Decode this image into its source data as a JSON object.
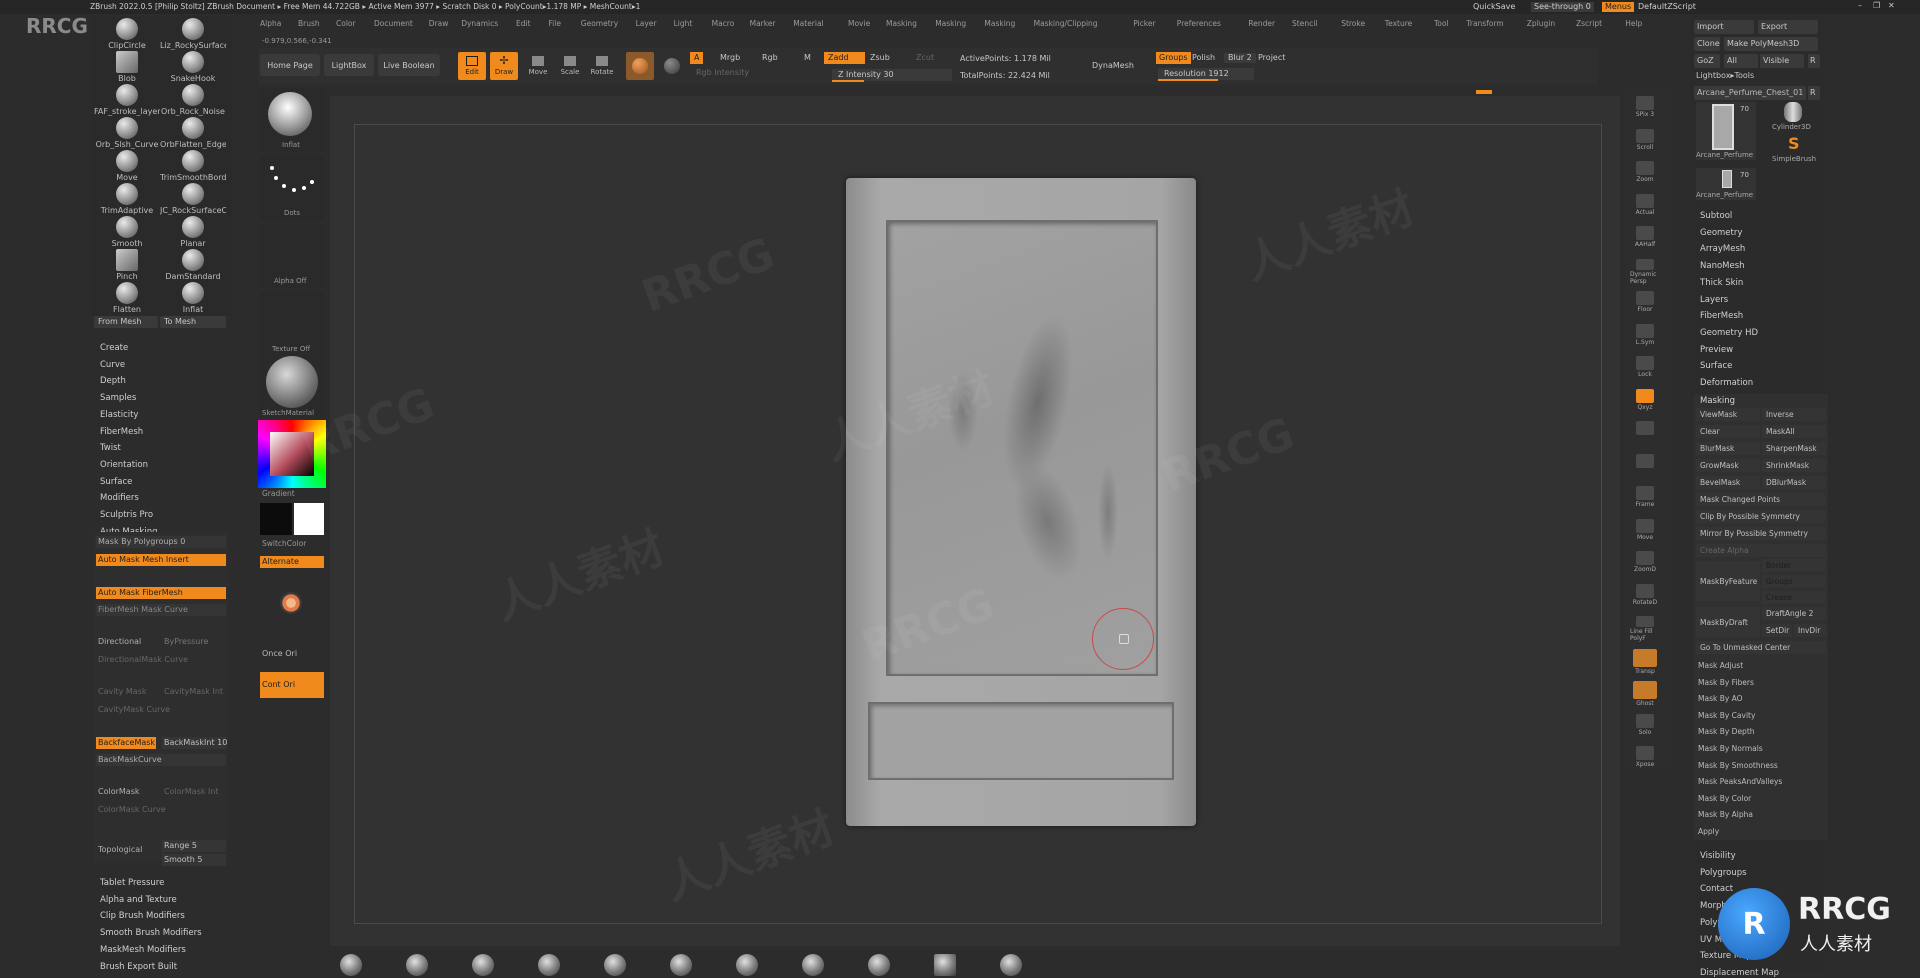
{
  "title_bar": {
    "text": "ZBrush 2022.0.5 [Philip Stoltz]   ZBrush Document   ▸ Free Mem 44.722GB ▸ Active Mem 3977 ▸ Scratch Disk 0 ▸ PolyCount▸1.178 MP ▸ MeshCount▸1",
    "quicksave": "QuickSave",
    "see_through": "See-through  0",
    "menus": "Menus",
    "default_script": "DefaultZScript"
  },
  "menu_bar": [
    "Alpha",
    "Brush",
    "Color",
    "Document",
    "Draw",
    "Dynamics",
    "Edit",
    "File",
    "Geometry",
    "Layer",
    "Light",
    "Macro",
    "Marker",
    "Material",
    "Movie",
    "Masking",
    "Masking",
    "Masking",
    "Masking/Clipping",
    "Picker",
    "Preferences",
    "Render",
    "Stencil",
    "Stroke",
    "Texture",
    "Tool",
    "Transform",
    "Zplugin",
    "Zscript",
    "Help"
  ],
  "coords": "-0.979,0.566,-0.341",
  "top_shelf": {
    "home_page": "Home Page",
    "lightbox": "LightBox",
    "live_boolean": "Live Boolean",
    "edit": "Edit",
    "draw": "Draw",
    "move": "Move",
    "scale": "Scale",
    "rotate": "Rotate",
    "a_label": "A",
    "mrgb": "Mrgb",
    "rgb": "Rgb",
    "m": "M",
    "zadd": "Zadd",
    "zsub": "Zsub",
    "zcut": "Zcut",
    "rgb_intensity": "Rgb Intensity",
    "z_intensity": "Z Intensity 30",
    "active_points": "ActivePoints: 1.178 Mil",
    "total_points": "TotalPoints: 22.424 Mil",
    "dynamesh": "DynaMesh",
    "groups": "Groups",
    "polish": "Polish",
    "blur": "Blur 2",
    "project": "Project",
    "resolution": "Resolution 1912"
  },
  "brushes": [
    {
      "name": "ClipCircle"
    },
    {
      "name": "Liz_RockySurface"
    },
    {
      "name": "Blob"
    },
    {
      "name": "SnakeHook"
    },
    {
      "name": "FAF_stroke_layer"
    },
    {
      "name": "Orb_Rock_Noise"
    },
    {
      "name": "Orb_Slsh_Curve"
    },
    {
      "name": "OrbFlatten_Edge"
    },
    {
      "name": "Move"
    },
    {
      "name": "TrimSmoothBord"
    },
    {
      "name": "TrimAdaptive"
    },
    {
      "name": "JC_RockSurfaceC"
    },
    {
      "name": "Smooth"
    },
    {
      "name": "Planar"
    },
    {
      "name": "Pinch"
    },
    {
      "name": "DamStandard"
    },
    {
      "name": "Flatten"
    },
    {
      "name": "Inflat"
    }
  ],
  "from_mesh": "From Mesh",
  "to_mesh": "To Mesh",
  "left_menu": [
    "Create",
    "Curve",
    "Depth",
    "Samples",
    "Elasticity",
    "FiberMesh",
    "Twist",
    "Orientation",
    "Surface",
    "Modifiers",
    "Sculptris Pro",
    "Auto Masking"
  ],
  "auto_masking": {
    "mask_by_polygroups": "Mask By Polygroups 0",
    "auto_mask_mesh_insert": "Auto Mask Mesh Insert",
    "auto_mask_fibermesh": "Auto Mask FiberMesh",
    "fibermesh_mask_curve": "FiberMesh Mask Curve",
    "directional": "Directional",
    "by_pressure": "ByPressure",
    "directional_mask_curve": "DirectionalMask Curve",
    "cavity_mask": "Cavity Mask",
    "cavity_mask_int": "CavityMask Int",
    "cavity_mask_curve": "CavityMask Curve",
    "backface_mask": "BackfaceMask",
    "backmask_int": "BackMaskInt 10",
    "backmask_curve": "BackMaskCurve",
    "color_mask": "ColorMask",
    "color_mask_int": "ColorMask Int",
    "color_mask_curve": "ColorMask Curve",
    "topological": "Topological",
    "range": "Range 5",
    "smooth": "Smooth 5"
  },
  "left_bottom_menu": [
    "Tablet Pressure",
    "Alpha and Texture",
    "Clip Brush Modifiers",
    "Smooth Brush Modifiers",
    "MaskMesh Modifiers",
    "Brush Export Built"
  ],
  "palette": {
    "inflat": "Inflat",
    "dots": "Dots",
    "alpha_off": "Alpha Off",
    "texture_off": "Texture Off",
    "material": "SketchMaterial",
    "gradient": "Gradient",
    "switch_color": "SwitchColor",
    "alternate": "Alternate",
    "once_ori": "Once Ori",
    "cont_ori": "Cont Ori"
  },
  "right_tools": [
    "SPix 3",
    "Scroll",
    "Zoom",
    "Actual",
    "AAHalf",
    "Dynamic Persp",
    "Floor",
    "L.Sym",
    "Lock",
    "Qxyz",
    "",
    "",
    "Frame",
    "Move",
    "ZoomD",
    "RotateD",
    "Line Fill PolyF",
    "Transp",
    "Ghost",
    "Solo",
    "Xpose"
  ],
  "tool_panel": {
    "import": "Import",
    "export": "Export",
    "clone": "Clone",
    "make_polymesh": "Make PolyMesh3D",
    "goz": "GoZ",
    "all": "All",
    "visible": "Visible",
    "r": "R",
    "lightbox_tools": "Lightbox▸Tools",
    "current_tool": "Arcane_Perfume_Chest_01",
    "tool_count_1": "70",
    "tool_name_1": "Arcane_Perfume",
    "cylinder": "Cylinder3D",
    "simplebrush": "SimpleBrush",
    "tool_count_2": "70",
    "tool_name_2": "Arcane_Perfume"
  },
  "tool_menu": [
    "Subtool",
    "Geometry",
    "ArrayMesh",
    "NanoMesh",
    "Thick Skin",
    "Layers",
    "FiberMesh",
    "Geometry HD",
    "Preview",
    "Surface",
    "Deformation"
  ],
  "masking": {
    "title": "Masking",
    "view_mask": "ViewMask",
    "inverse": "Inverse",
    "clear": "Clear",
    "mask_all": "MaskAll",
    "blur_mask": "BlurMask",
    "sharpen_mask": "SharpenMask",
    "grow_mask": "GrowMask",
    "shrink_mask": "ShrinkMask",
    "bevel_mask": "BevelMask",
    "blur_mask2": "DBlurMask",
    "mask_changed": "Mask Changed Points",
    "clip_by_symmetry": "Clip By Possible Symmetry",
    "mirror_by_symmetry": "Mirror By Possible Symmetry",
    "create_alpha": "Create Alpha",
    "mask_by_feature": "MaskByFeature",
    "border": "Border",
    "groups": "Groups",
    "crease": "Crease",
    "mask_by_draft": "MaskByDraft",
    "draft_angle": "DraftAngle 2",
    "set_dir": "SetDir",
    "inv_dir": "InvDir",
    "goto_unmasked": "Go To Unmasked Center",
    "items": [
      "Mask Adjust",
      "Mask By Fibers",
      "Mask By AO",
      "Mask By Cavity",
      "Mask By Depth",
      "Mask By Normals",
      "Mask By Smoothness",
      "Mask PeaksAndValleys",
      "Mask By Color",
      "Mask By Alpha",
      "Apply"
    ]
  },
  "tool_menu_bottom": [
    "Visibility",
    "Polygroups",
    "Contact",
    "Morph Target",
    "Polypaint",
    "UV Map",
    "Texture Map",
    "Displacement Map"
  ],
  "bottom_spheres": 11,
  "watermarks": {
    "rrcg": "RRCG",
    "cn": "人人素材",
    "logo_cn": "人人素材"
  }
}
